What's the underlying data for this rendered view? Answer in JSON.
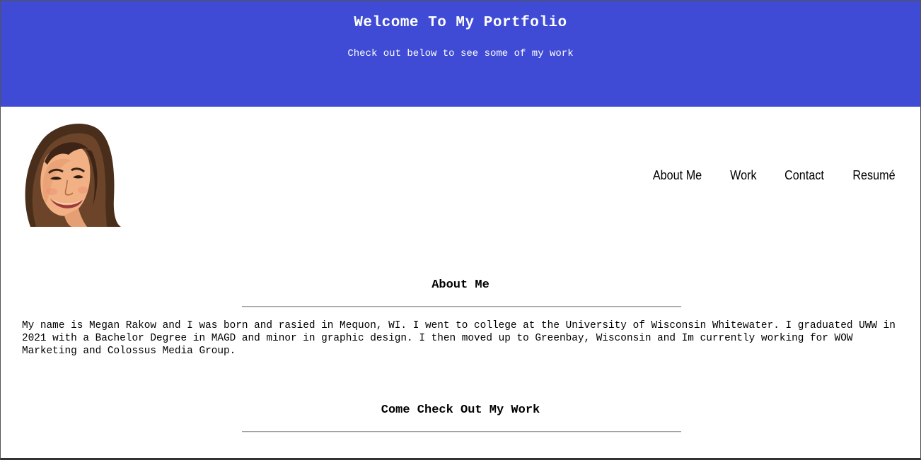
{
  "hero": {
    "title": "Welcome To My Portfolio",
    "subtitle": "Check out below to see some of my work",
    "background_color": "#3f4bd4"
  },
  "avatar": {
    "alt": "Illustrated portrait"
  },
  "nav": {
    "items": [
      {
        "label": "About Me"
      },
      {
        "label": "Work"
      },
      {
        "label": "Contact"
      },
      {
        "label": "Resumé"
      }
    ]
  },
  "about": {
    "heading": "About Me",
    "body": "My name is Megan Rakow and I was born and rasied in Mequon, WI. I went to college at the University of Wisconsin Whitewater. I graduated UWW in 2021 with a Bachelor Degree in MAGD and minor in graphic design. I then moved up to Greenbay, Wisconsin and Im currently working for WOW Marketing and Colossus Media Group."
  },
  "work": {
    "heading": "Come Check Out My Work"
  }
}
